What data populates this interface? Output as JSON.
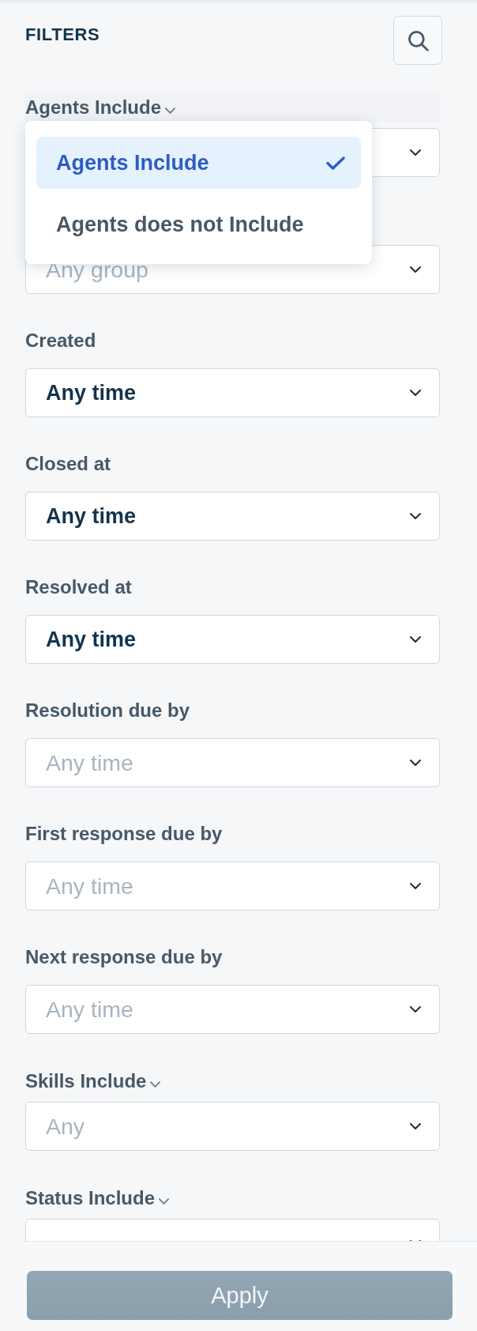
{
  "header": {
    "title": "FILTERS"
  },
  "filters": [
    {
      "kind": "include",
      "label": "Agents Include",
      "expanded": true,
      "menu": [
        {
          "label": "Agents Include",
          "selected": true
        },
        {
          "label": "Agents does not Include",
          "selected": false
        }
      ]
    },
    {
      "kind": "include",
      "placeholder": "Any group"
    },
    {
      "kind": "plain",
      "label": "Created",
      "value": "Any time"
    },
    {
      "kind": "plain",
      "label": "Closed at",
      "value": "Any time"
    },
    {
      "kind": "plain",
      "label": "Resolved at",
      "value": "Any time"
    },
    {
      "kind": "plain",
      "label": "Resolution due by",
      "placeholder": "Any time"
    },
    {
      "kind": "plain",
      "label": "First response due by",
      "placeholder": "Any time"
    },
    {
      "kind": "plain",
      "label": "Next response due by",
      "placeholder": "Any time"
    },
    {
      "kind": "include",
      "label": "Skills Include",
      "expanded": false,
      "placeholder": "Any"
    },
    {
      "kind": "include",
      "label": "Status Include",
      "expanded": false
    }
  ],
  "apply_button": {
    "label": "Apply",
    "disabled": true
  }
}
